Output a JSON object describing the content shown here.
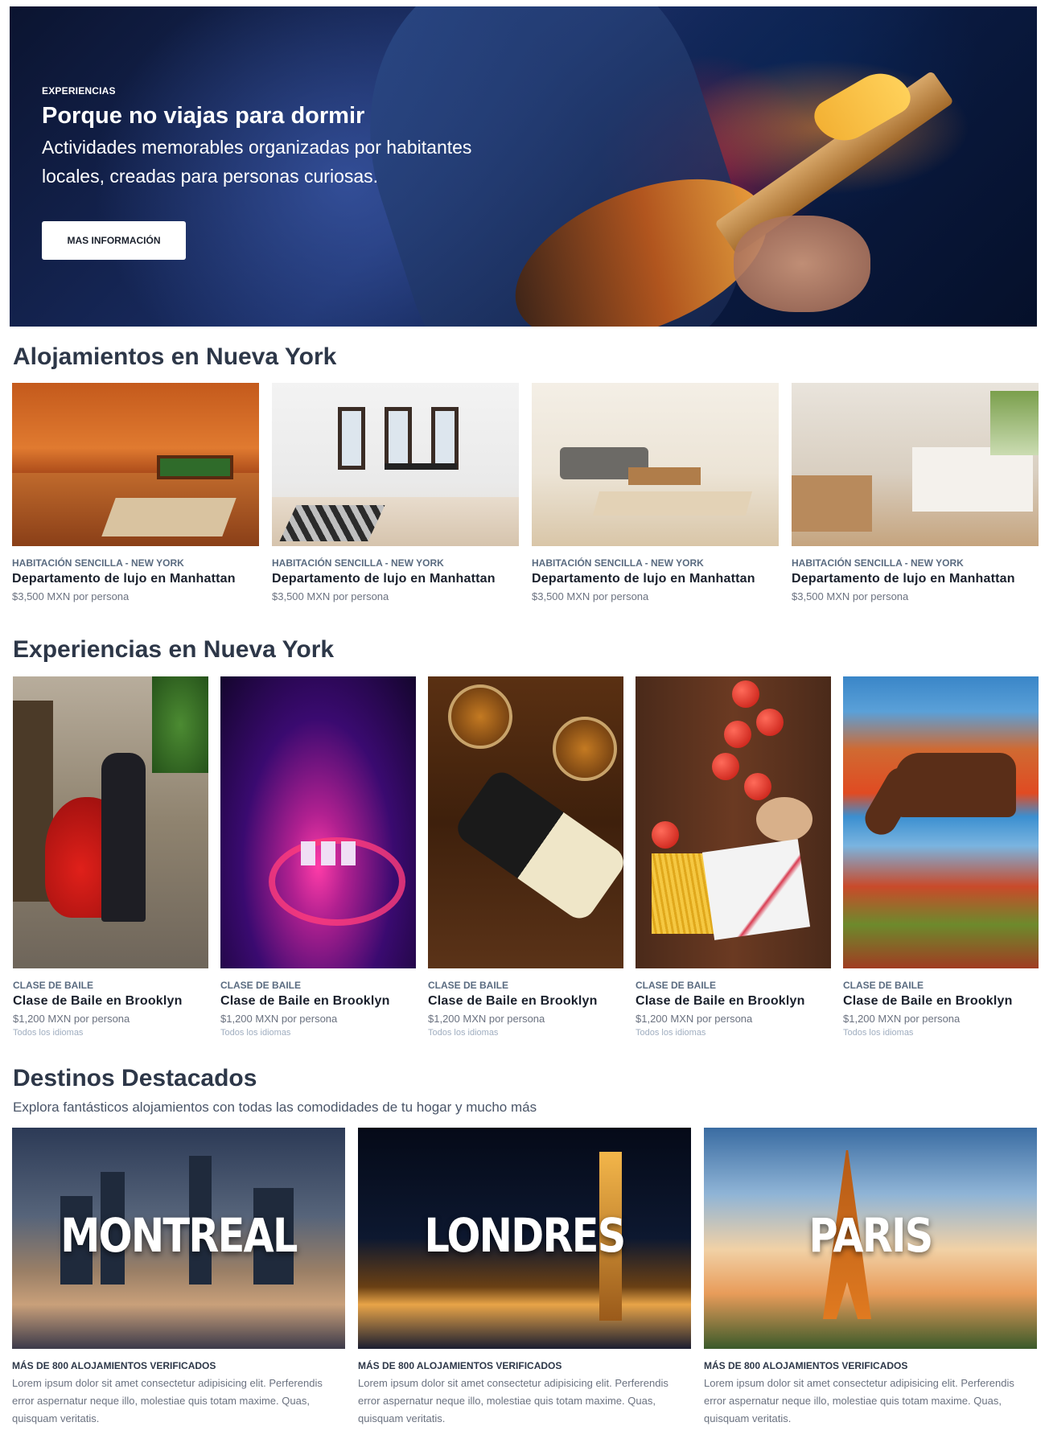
{
  "hero": {
    "eyebrow": "EXPERIENCIAS",
    "title": "Porque no viajas para dormir",
    "subtitle_line1": "Actividades memorables organizadas por habitantes",
    "subtitle_line2": "locales, creadas para personas curiosas.",
    "button_label": "MAS INFORMACIÓN"
  },
  "accommodations": {
    "heading": "Alojamientos en Nueva York",
    "items": [
      {
        "category": "HABITACIÓN SENCILLA - NEW YORK",
        "title": "Departamento de lujo en Manhattan",
        "price": "$3,500 MXN por persona",
        "image": "living-room-photo"
      },
      {
        "category": "HABITACIÓN SENCILLA - NEW YORK",
        "title": "Departamento de lujo en Manhattan",
        "price": "$3,500 MXN por persona",
        "image": "dining-room-photo"
      },
      {
        "category": "HABITACIÓN SENCILLA - NEW YORK",
        "title": "Departamento de lujo en Manhattan",
        "price": "$3,500 MXN por persona",
        "image": "lounge-photo"
      },
      {
        "category": "HABITACIÓN SENCILLA - NEW YORK",
        "title": "Departamento de lujo en Manhattan",
        "price": "$3,500 MXN por persona",
        "image": "kitchen-photo"
      }
    ]
  },
  "experiences": {
    "heading": "Experiencias en Nueva York",
    "items": [
      {
        "category": "CLASE DE BAILE",
        "title": "Clase de Baile en Brooklyn",
        "price": "$1,200 MXN por persona",
        "languages": "Todos los idiomas",
        "image": "tango-photo"
      },
      {
        "category": "CLASE DE BAILE",
        "title": "Clase de Baile en Brooklyn",
        "price": "$1,200 MXN por persona",
        "languages": "Todos los idiomas",
        "image": "dj-photo"
      },
      {
        "category": "CLASE DE BAILE",
        "title": "Clase de Baile en Brooklyn",
        "price": "$1,200 MXN por persona",
        "languages": "Todos los idiomas",
        "image": "whisky-photo"
      },
      {
        "category": "CLASE DE BAILE",
        "title": "Clase de Baile en Brooklyn",
        "price": "$1,200 MXN por persona",
        "languages": "Todos los idiomas",
        "image": "cooking-photo"
      },
      {
        "category": "CLASE DE BAILE",
        "title": "Clase de Baile en Brooklyn",
        "price": "$1,200 MXN por persona",
        "languages": "Todos los idiomas",
        "image": "horse-photo"
      }
    ]
  },
  "destinations": {
    "heading": "Destinos Destacados",
    "subtitle": "Explora fantásticos alojamientos con todas las comodidades de tu hogar y mucho más",
    "items": [
      {
        "city": "MONTREAL",
        "label": "MÁS DE 800 ALOJAMIENTOS VERIFICADOS",
        "description": "Lorem ipsum dolor sit amet consectetur adipisicing elit. Perferendis error aspernatur neque illo, molestiae quis totam maxime. Quas, quisquam veritatis."
      },
      {
        "city": "LONDRES",
        "label": "MÁS DE 800 ALOJAMIENTOS VERIFICADOS",
        "description": "Lorem ipsum dolor sit amet consectetur adipisicing elit. Perferendis error aspernatur neque illo, molestiae quis totam maxime. Quas, quisquam veritatis."
      },
      {
        "city": "PARIS",
        "label": "MÁS DE 800 ALOJAMIENTOS VERIFICADOS",
        "description": "Lorem ipsum dolor sit amet consectetur adipisicing elit. Perferendis error aspernatur neque illo, molestiae quis totam maxime. Quas, quisquam veritatis."
      }
    ]
  }
}
